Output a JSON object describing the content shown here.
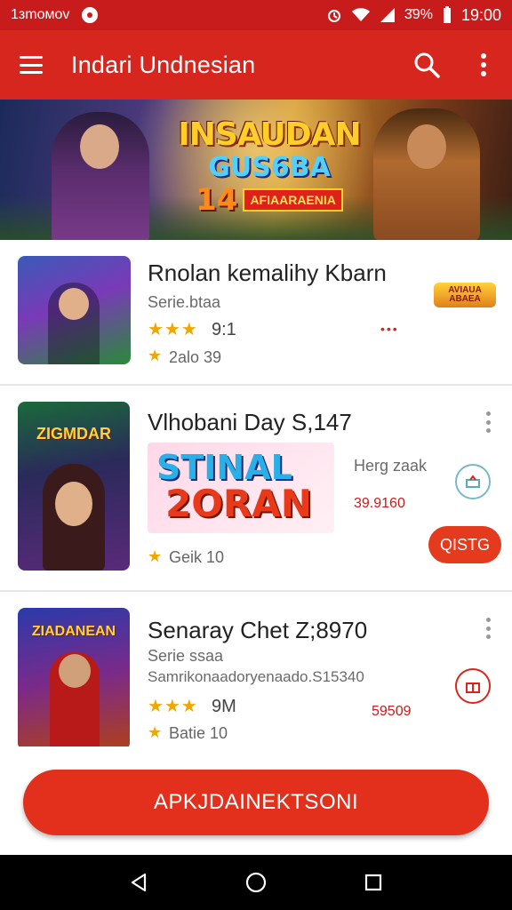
{
  "status_bar": {
    "carrier": "1зmoмov",
    "battery": "3̄9%",
    "time": "19:00"
  },
  "app_bar": {
    "title": "Indari Undnesian"
  },
  "banner": {
    "line1": "INSAUDAN",
    "line2": "GUS6BA",
    "line3_num": "14",
    "line3_tag": "AFIAARAENIA"
  },
  "items": [
    {
      "name": "Rnolan kemalihy Kbarn",
      "subtitle": "Serie.btaa",
      "stars": "★★★",
      "rating": "9:1",
      "secondary": "2alo 39",
      "badge": "AVIAUA ABAEA"
    },
    {
      "name": "Vlhobani Day S,147",
      "thumb_title": "ZIGMDAR",
      "promo_line1": "STINAL",
      "promo_line2": "2ORAN",
      "side_label": "Herg zaak",
      "price": "39.9160",
      "secondary": "Geik 10",
      "button_label": "QISTG"
    },
    {
      "name": "Senaray Chet Z;8970",
      "thumb_title": "ZIADANEAN",
      "subtitle": "Serie ssaa",
      "description": "Samrikonaadoryenaado.S15340",
      "stars": "★★★",
      "rating": "9M",
      "secondary": "Batie 10",
      "price": "59509"
    }
  ],
  "cta": {
    "label": "APKJDAINEKTSONI"
  },
  "colors": {
    "primary": "#d7261e",
    "status_bar": "#c81c1c",
    "star": "#f0a800",
    "cta": "#e3301c"
  }
}
